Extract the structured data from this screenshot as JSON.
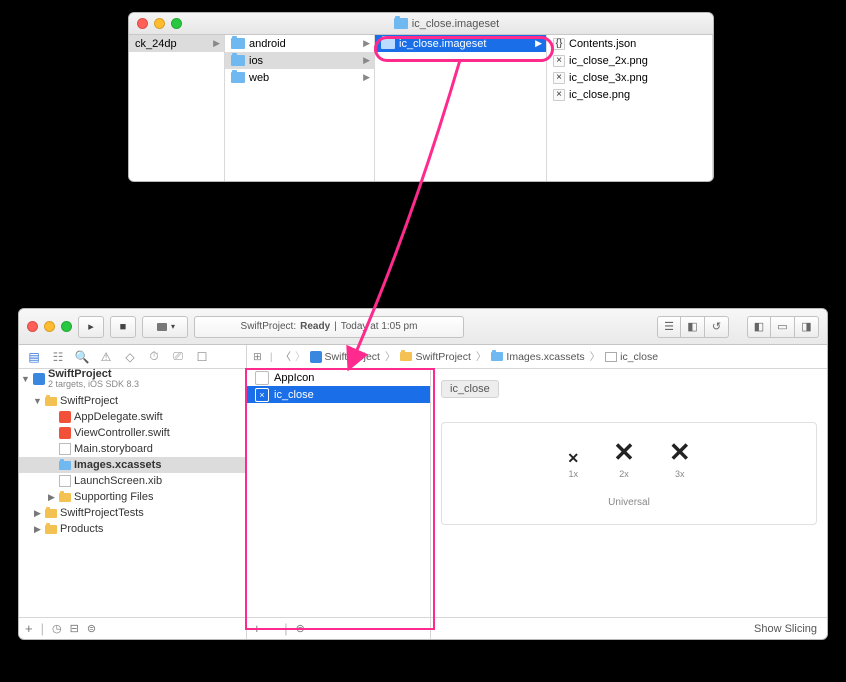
{
  "finder": {
    "title": "ic_close.imageset",
    "col0": {
      "item": "ck_24dp"
    },
    "col1": {
      "items": [
        "android",
        "ios",
        "web"
      ]
    },
    "col2": {
      "items": [
        "ic_close.imageset"
      ]
    },
    "col3": {
      "items": [
        "Contents.json",
        "ic_close_2x.png",
        "ic_close_3x.png",
        "ic_close.png"
      ]
    }
  },
  "xcode": {
    "status_project": "SwiftProject:",
    "status_state": "Ready",
    "status_sep": "|",
    "status_time": "Today at 1:05 pm",
    "breadcrumb": [
      "SwiftProject",
      "SwiftProject",
      "Images.xcassets",
      "ic_close"
    ],
    "tree": {
      "root": "SwiftProject",
      "root_sub": "2 targets, iOS SDK 8.3",
      "group1": "SwiftProject",
      "files": [
        "AppDelegate.swift",
        "ViewController.swift",
        "Main.storyboard",
        "Images.xcassets",
        "LaunchScreen.xib"
      ],
      "supporting": "Supporting Files",
      "tests": "SwiftProjectTests",
      "products": "Products"
    },
    "assets": {
      "list": [
        "AppIcon",
        "ic_close"
      ],
      "preview_title": "ic_close",
      "scales": [
        "1x",
        "2x",
        "3x"
      ],
      "universal": "Universal"
    },
    "show_slicing": "Show Slicing"
  }
}
